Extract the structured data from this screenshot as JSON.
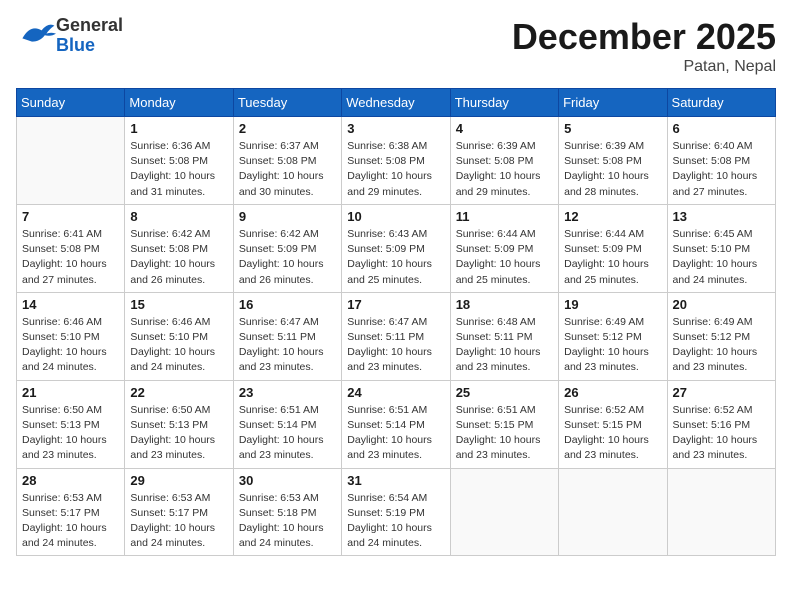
{
  "header": {
    "logo_general": "General",
    "logo_blue": "Blue",
    "month": "December 2025",
    "location": "Patan, Nepal"
  },
  "days_of_week": [
    "Sunday",
    "Monday",
    "Tuesday",
    "Wednesday",
    "Thursday",
    "Friday",
    "Saturday"
  ],
  "weeks": [
    [
      {
        "day": "",
        "info": ""
      },
      {
        "day": "1",
        "info": "Sunrise: 6:36 AM\nSunset: 5:08 PM\nDaylight: 10 hours\nand 31 minutes."
      },
      {
        "day": "2",
        "info": "Sunrise: 6:37 AM\nSunset: 5:08 PM\nDaylight: 10 hours\nand 30 minutes."
      },
      {
        "day": "3",
        "info": "Sunrise: 6:38 AM\nSunset: 5:08 PM\nDaylight: 10 hours\nand 29 minutes."
      },
      {
        "day": "4",
        "info": "Sunrise: 6:39 AM\nSunset: 5:08 PM\nDaylight: 10 hours\nand 29 minutes."
      },
      {
        "day": "5",
        "info": "Sunrise: 6:39 AM\nSunset: 5:08 PM\nDaylight: 10 hours\nand 28 minutes."
      },
      {
        "day": "6",
        "info": "Sunrise: 6:40 AM\nSunset: 5:08 PM\nDaylight: 10 hours\nand 27 minutes."
      }
    ],
    [
      {
        "day": "7",
        "info": "Sunrise: 6:41 AM\nSunset: 5:08 PM\nDaylight: 10 hours\nand 27 minutes."
      },
      {
        "day": "8",
        "info": "Sunrise: 6:42 AM\nSunset: 5:08 PM\nDaylight: 10 hours\nand 26 minutes."
      },
      {
        "day": "9",
        "info": "Sunrise: 6:42 AM\nSunset: 5:09 PM\nDaylight: 10 hours\nand 26 minutes."
      },
      {
        "day": "10",
        "info": "Sunrise: 6:43 AM\nSunset: 5:09 PM\nDaylight: 10 hours\nand 25 minutes."
      },
      {
        "day": "11",
        "info": "Sunrise: 6:44 AM\nSunset: 5:09 PM\nDaylight: 10 hours\nand 25 minutes."
      },
      {
        "day": "12",
        "info": "Sunrise: 6:44 AM\nSunset: 5:09 PM\nDaylight: 10 hours\nand 25 minutes."
      },
      {
        "day": "13",
        "info": "Sunrise: 6:45 AM\nSunset: 5:10 PM\nDaylight: 10 hours\nand 24 minutes."
      }
    ],
    [
      {
        "day": "14",
        "info": "Sunrise: 6:46 AM\nSunset: 5:10 PM\nDaylight: 10 hours\nand 24 minutes."
      },
      {
        "day": "15",
        "info": "Sunrise: 6:46 AM\nSunset: 5:10 PM\nDaylight: 10 hours\nand 24 minutes."
      },
      {
        "day": "16",
        "info": "Sunrise: 6:47 AM\nSunset: 5:11 PM\nDaylight: 10 hours\nand 23 minutes."
      },
      {
        "day": "17",
        "info": "Sunrise: 6:47 AM\nSunset: 5:11 PM\nDaylight: 10 hours\nand 23 minutes."
      },
      {
        "day": "18",
        "info": "Sunrise: 6:48 AM\nSunset: 5:11 PM\nDaylight: 10 hours\nand 23 minutes."
      },
      {
        "day": "19",
        "info": "Sunrise: 6:49 AM\nSunset: 5:12 PM\nDaylight: 10 hours\nand 23 minutes."
      },
      {
        "day": "20",
        "info": "Sunrise: 6:49 AM\nSunset: 5:12 PM\nDaylight: 10 hours\nand 23 minutes."
      }
    ],
    [
      {
        "day": "21",
        "info": "Sunrise: 6:50 AM\nSunset: 5:13 PM\nDaylight: 10 hours\nand 23 minutes."
      },
      {
        "day": "22",
        "info": "Sunrise: 6:50 AM\nSunset: 5:13 PM\nDaylight: 10 hours\nand 23 minutes."
      },
      {
        "day": "23",
        "info": "Sunrise: 6:51 AM\nSunset: 5:14 PM\nDaylight: 10 hours\nand 23 minutes."
      },
      {
        "day": "24",
        "info": "Sunrise: 6:51 AM\nSunset: 5:14 PM\nDaylight: 10 hours\nand 23 minutes."
      },
      {
        "day": "25",
        "info": "Sunrise: 6:51 AM\nSunset: 5:15 PM\nDaylight: 10 hours\nand 23 minutes."
      },
      {
        "day": "26",
        "info": "Sunrise: 6:52 AM\nSunset: 5:15 PM\nDaylight: 10 hours\nand 23 minutes."
      },
      {
        "day": "27",
        "info": "Sunrise: 6:52 AM\nSunset: 5:16 PM\nDaylight: 10 hours\nand 23 minutes."
      }
    ],
    [
      {
        "day": "28",
        "info": "Sunrise: 6:53 AM\nSunset: 5:17 PM\nDaylight: 10 hours\nand 24 minutes."
      },
      {
        "day": "29",
        "info": "Sunrise: 6:53 AM\nSunset: 5:17 PM\nDaylight: 10 hours\nand 24 minutes."
      },
      {
        "day": "30",
        "info": "Sunrise: 6:53 AM\nSunset: 5:18 PM\nDaylight: 10 hours\nand 24 minutes."
      },
      {
        "day": "31",
        "info": "Sunrise: 6:54 AM\nSunset: 5:19 PM\nDaylight: 10 hours\nand 24 minutes."
      },
      {
        "day": "",
        "info": ""
      },
      {
        "day": "",
        "info": ""
      },
      {
        "day": "",
        "info": ""
      }
    ]
  ]
}
